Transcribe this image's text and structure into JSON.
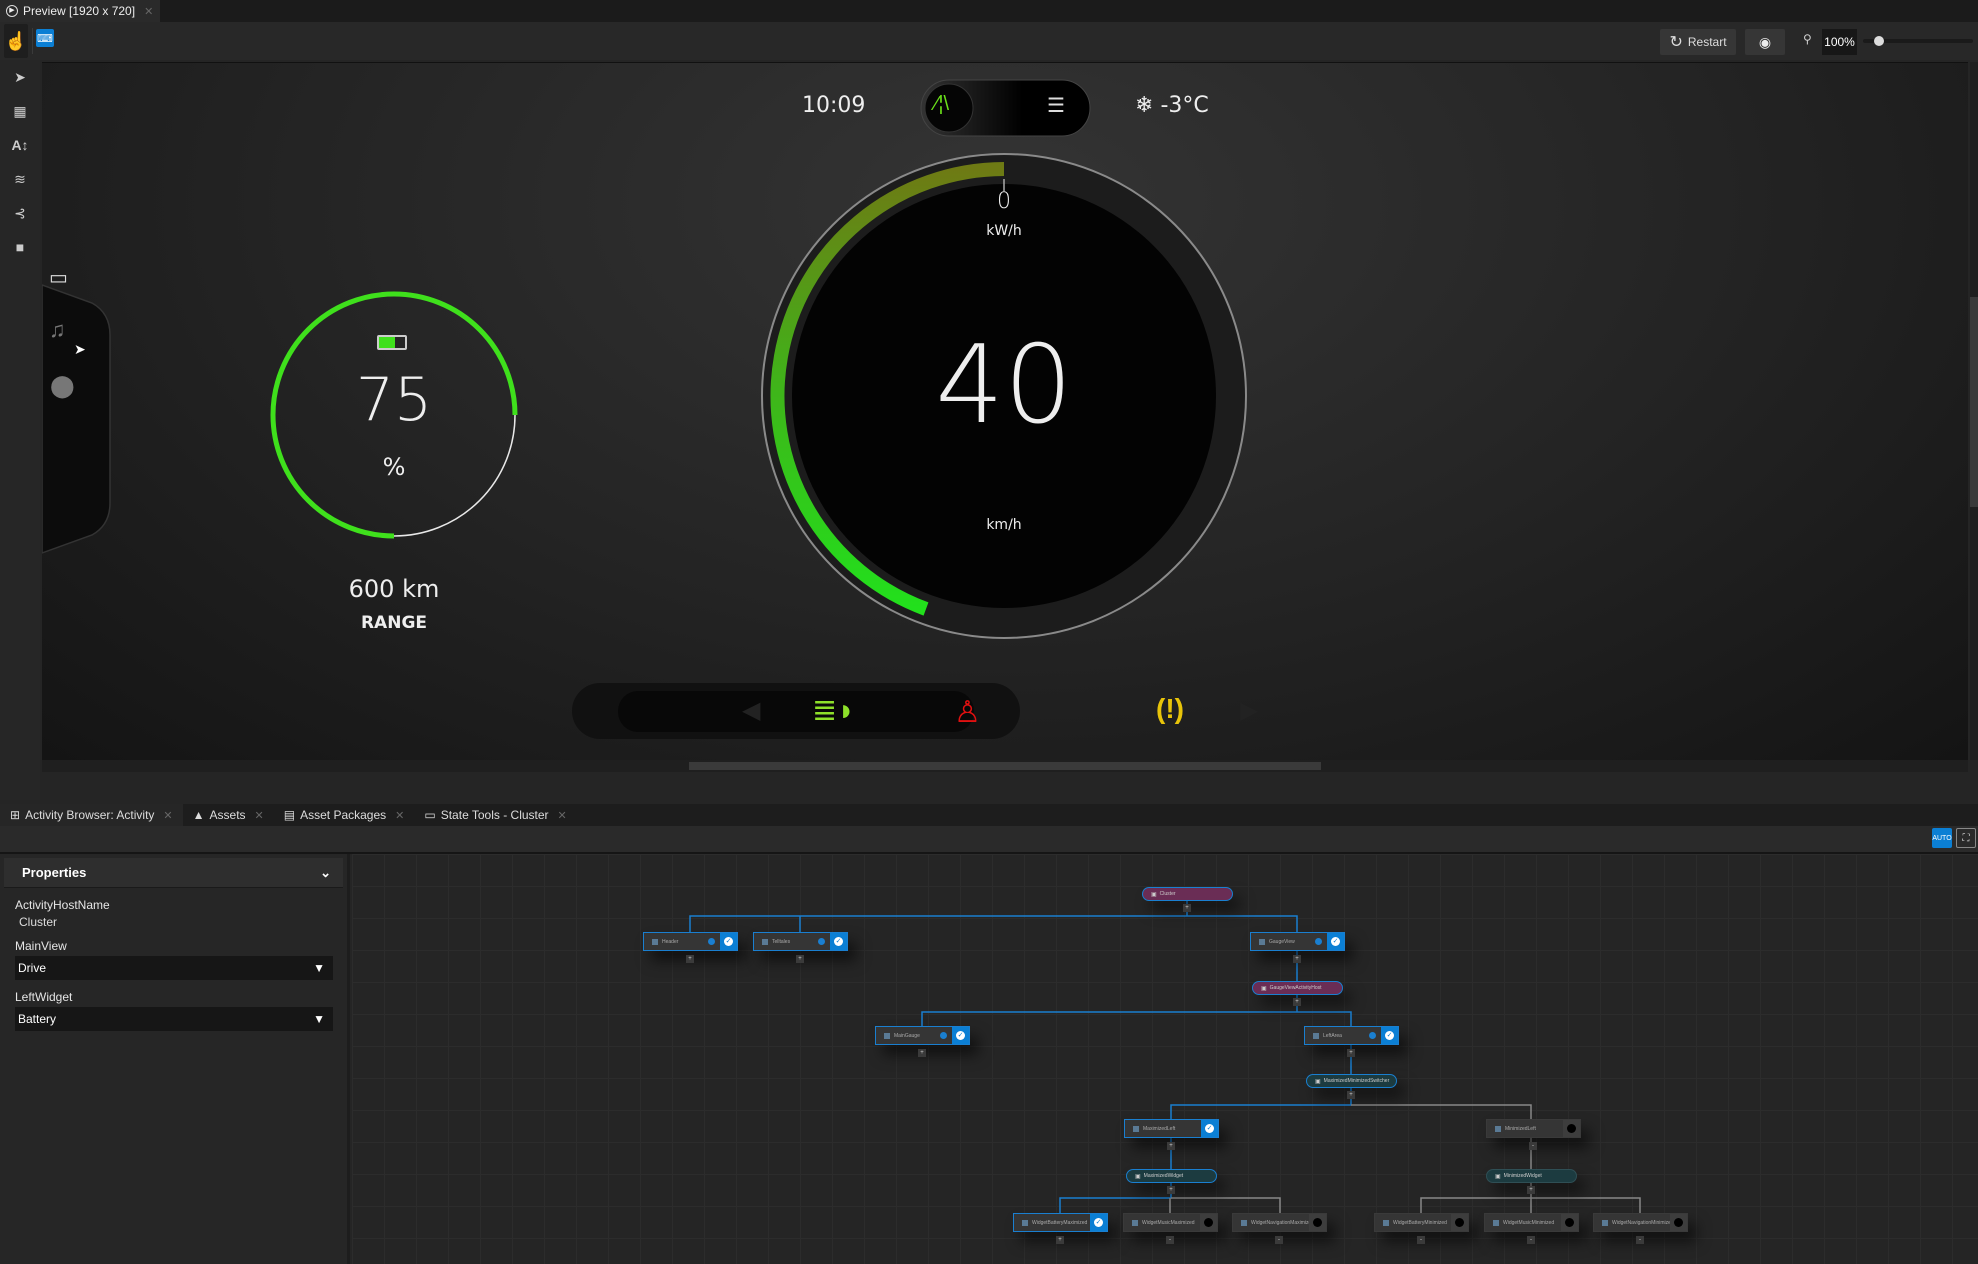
{
  "window": {
    "tab_title": "Preview [1920 x 720]"
  },
  "toolbar": {
    "restart_label": "Restart",
    "zoom_value": "100%",
    "zoom_slider_fraction": 0.1
  },
  "left_tools": [
    "pointer-icon",
    "table-icon",
    "text-icon",
    "layers-icon",
    "connection-icon",
    "camera-icon"
  ],
  "cluster": {
    "time": "10:09",
    "temperature": "-3°C",
    "power_value": "0",
    "power_unit": "kW/h",
    "speed_value": "40",
    "speed_unit": "km/h",
    "battery_percent_value": "75",
    "battery_percent": 75,
    "battery_unit": "%",
    "range_value": "600 km",
    "range_label": "RANGE",
    "colors": {
      "green": "#3fe01c",
      "telltale_green": "#8ee02a",
      "telltale_red": "#e01010",
      "telltale_yellow": "#e8c40a"
    },
    "side_widgets": [
      "battery-icon",
      "music-icon",
      "location-icon"
    ],
    "telltales": [
      "headlight-icon",
      "seatbelt-icon",
      "tire-pressure-icon"
    ]
  },
  "bottom_tabs": [
    {
      "label": "Activity Browser: Activity"
    },
    {
      "label": "Assets"
    },
    {
      "label": "Asset Packages"
    },
    {
      "label": "State Tools - Cluster"
    }
  ],
  "properties": {
    "title": "Properties",
    "activity_host_name_label": "ActivityHostName",
    "activity_host_name_value": "Cluster",
    "main_view_label": "MainView",
    "main_view_value": "Drive",
    "left_widget_label": "LeftWidget",
    "left_widget_value": "Battery"
  },
  "graph": {
    "hosts": [
      {
        "label": "Cluster",
        "style": "purple"
      },
      {
        "label": "GaugeViewActivityHost",
        "style": "purple"
      },
      {
        "label": "MaximizedMinimizedSwitcher",
        "style": "teal"
      },
      {
        "label": "MaximizedWidget",
        "style": "teal"
      },
      {
        "label": "MinimizedWidget",
        "style": "teal"
      }
    ],
    "nodes": [
      {
        "label": "Header",
        "active": true
      },
      {
        "label": "Telltales",
        "active": true
      },
      {
        "label": "GaugeView",
        "active": true
      },
      {
        "label": "MainGauge",
        "active": true
      },
      {
        "label": "LeftArea",
        "active": true
      },
      {
        "label": "MaximizedLeft",
        "active": true
      },
      {
        "label": "MinimizedLeft",
        "active": false
      },
      {
        "label": "WidgetBatteryMaximized",
        "active": true
      },
      {
        "label": "WidgetMusicMaximized",
        "active": false
      },
      {
        "label": "WidgetNavigationMaximized",
        "active": false
      },
      {
        "label": "WidgetBatteryMinimized",
        "active": false
      },
      {
        "label": "WidgetMusicMinimized",
        "active": false
      },
      {
        "label": "WidgetNavigationMinimized",
        "active": false
      }
    ]
  }
}
